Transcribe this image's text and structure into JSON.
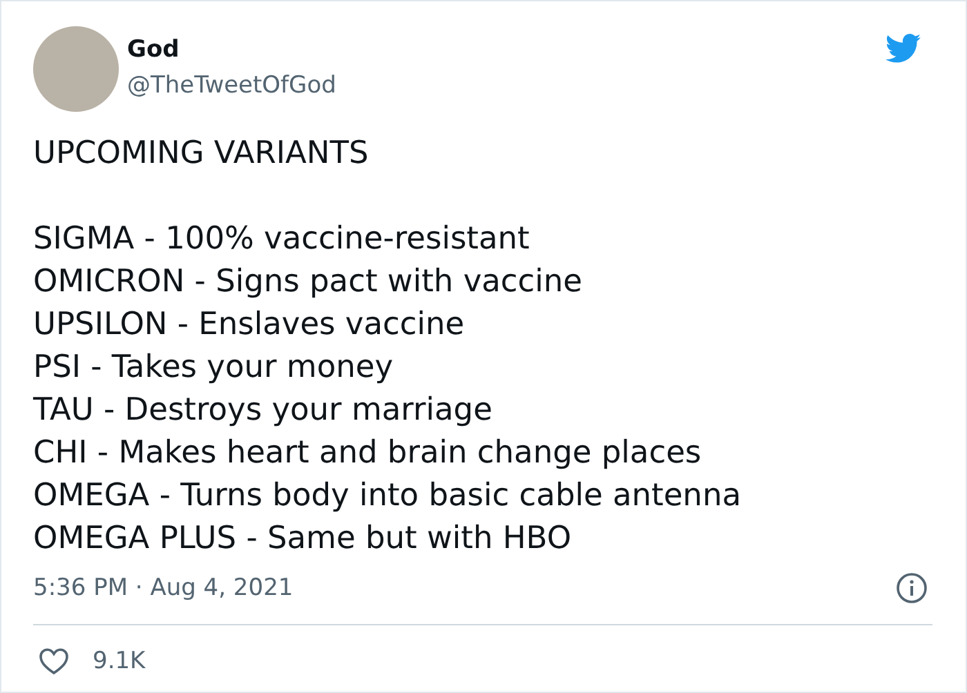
{
  "author": {
    "name": "God",
    "handle": "@TheTweetOfGod"
  },
  "tweet": {
    "heading": "UPCOMING VARIANTS",
    "lines": [
      "SIGMA - 100% vaccine-resistant",
      "OMICRON - Signs pact with vaccine",
      "UPSILON - Enslaves vaccine",
      "PSI - Takes your money",
      "TAU - Destroys your marriage",
      "CHI - Makes heart and brain change places",
      "OMEGA - Turns body into basic cable antenna",
      "OMEGA PLUS - Same but with HBO"
    ]
  },
  "timestamp": "5:36 PM · Aug 4, 2021",
  "likes": {
    "count": "9.1K"
  }
}
